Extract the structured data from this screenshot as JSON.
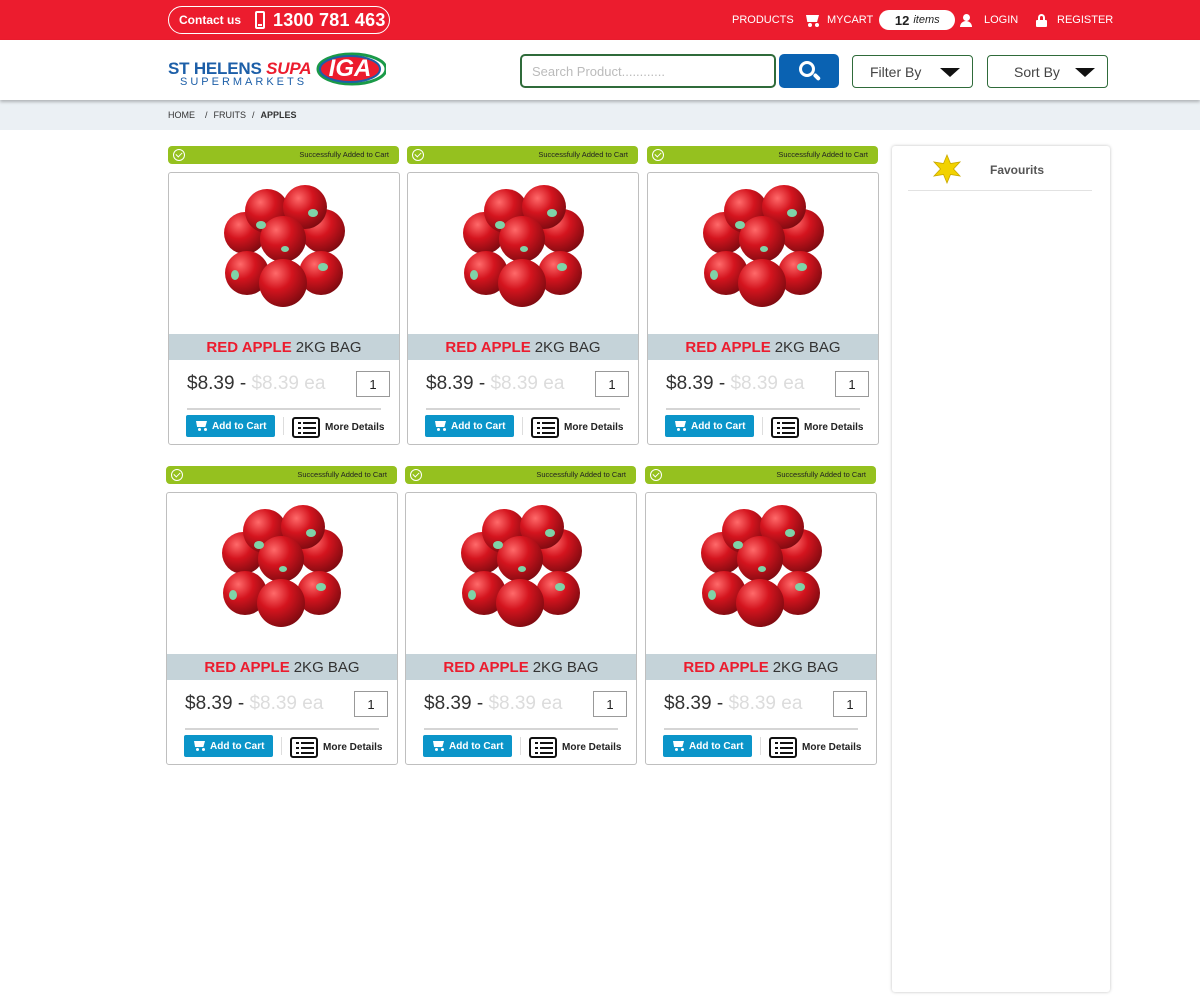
{
  "topbar": {
    "contact_label": "Contact us",
    "phone": "1300 781 463",
    "products": "PRODUCTS",
    "mycart": "MYCART",
    "cart_count": "12",
    "cart_items_label": "items",
    "login": "LOGIN",
    "register": "REGISTER",
    "color": "#ec1c2e"
  },
  "header": {
    "logo_name": "ST HELENS",
    "logo_supa": "SUPA",
    "logo_badge": "IGA",
    "logo_sub": "SUPERMARKETS",
    "search_placeholder": "Search Product............",
    "filter_label": "Filter By",
    "sort_label": "Sort By"
  },
  "breadcrumb": {
    "home": "HOME",
    "sep": "/",
    "fruits": "FRUITS",
    "current": "APPLES"
  },
  "products": [
    {
      "success": "Successfully Added to Cart",
      "name": "RED APPLE",
      "size": "2KG BAG",
      "price": "$8.39",
      "dash": "-",
      "unit_price": "$8.39 ea",
      "qty": "1",
      "add_label": "Add to Cart",
      "more_label": "More Details"
    },
    {
      "success": "Successfully Added to Cart",
      "name": "RED APPLE",
      "size": "2KG BAG",
      "price": "$8.39",
      "dash": "-",
      "unit_price": "$8.39 ea",
      "qty": "1",
      "add_label": "Add to Cart",
      "more_label": "More Details"
    },
    {
      "success": "Successfully Added to Cart",
      "name": "RED APPLE",
      "size": "2KG BAG",
      "price": "$8.39",
      "dash": "-",
      "unit_price": "$8.39 ea",
      "qty": "1",
      "add_label": "Add to Cart",
      "more_label": "More Details"
    },
    {
      "success": "Successfully Added to Cart",
      "name": "RED APPLE",
      "size": "2KG BAG",
      "price": "$8.39",
      "dash": "-",
      "unit_price": "$8.39 ea",
      "qty": "1",
      "add_label": "Add to Cart",
      "more_label": "More Details"
    },
    {
      "success": "Successfully Added to Cart",
      "name": "RED APPLE",
      "size": "2KG BAG",
      "price": "$8.39",
      "dash": "-",
      "unit_price": "$8.39 ea",
      "qty": "1",
      "add_label": "Add to Cart",
      "more_label": "More Details"
    },
    {
      "success": "Successfully Added to Cart",
      "name": "RED APPLE",
      "size": "2KG BAG",
      "price": "$8.39",
      "dash": "-",
      "unit_price": "$8.39 ea",
      "qty": "1",
      "add_label": "Add to Cart",
      "more_label": "More Details"
    }
  ],
  "sidebar": {
    "favourites_label": "Favourits",
    "favourites_icon": "star-icon"
  },
  "colors": {
    "brand_red": "#ec1c2e",
    "brand_blue": "#0a62b2",
    "success_green": "#95c11f",
    "cart_button": "#0b95c9"
  }
}
